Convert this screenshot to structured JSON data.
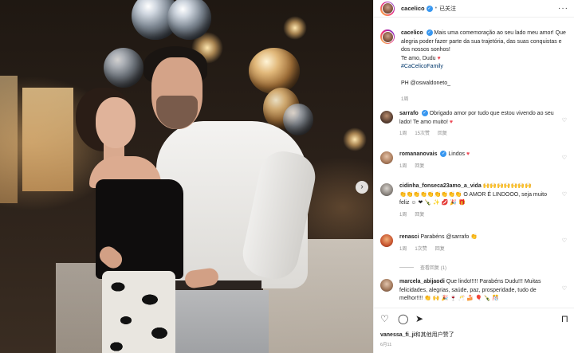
{
  "header": {
    "username": "cacelico",
    "verified_badge": "✓",
    "separator": "•",
    "follow_state": "已关注",
    "more_label": "···"
  },
  "caption": {
    "username": "cacelico",
    "verified_badge": "✓",
    "line1": "Mais uma comemoração ao seu lado meu amor! Que",
    "line2": "alegria poder fazer parte da sua trajetória, das suas conquistas e",
    "line3": "dos nossos sonhos!",
    "line4": "Te amo, Dudu",
    "heart": "♥",
    "hashtag": "#CaCelicoFamily",
    "credit": "PH @oswaldoneto_",
    "time": "1周"
  },
  "comments": [
    {
      "username": "sarrafo",
      "verified_badge": "✓",
      "line1": "Obrigado amor por tudo que estou vivendo ao seu",
      "line2": "lado! Te amo muito!",
      "heart": "♥",
      "time": "1周",
      "likes": "15次赞",
      "reply": "回复"
    },
    {
      "username": "romananovais",
      "verified_badge": "✓",
      "text": "Lindos",
      "heart": "♥",
      "time": "1周",
      "reply": "回复"
    },
    {
      "username": "cidinha_fonseca23amo_a_vida",
      "line1": "🙌🙌🙌🙌🙌🙌🙌",
      "line2": "👏👏👏👏👏👏👏👏👏 O AMOR É LINDOOO, seja muito",
      "line3": "feliz ☺ ❤ 🍾 ✨ 💋 🎉 🎁",
      "time": "1周",
      "reply": "回复"
    },
    {
      "username": "renasci",
      "text": "Parabéns @sarrafo 👏",
      "time": "1周",
      "likes": "1次赞",
      "reply": "回复",
      "view_replies": "查看回复 (1)"
    },
    {
      "username": "marcela_abijaodi",
      "line1": "Que lindo!!!!! Parabéns Dudu!!! Muitas",
      "line2": "felicidades, alegrias, saúde, paz, prosperidade, tudo de",
      "line3": "melhor!!!! 👏 🙌 🎉 🍷 🥂 🍰 🎈 🍾 🎊",
      "time": "1周"
    }
  ],
  "icons": {
    "like": "♡",
    "comment": "◯",
    "share": "➤",
    "save": "⊓",
    "comment_like": "♡",
    "next": "›"
  },
  "likes_line": {
    "user": "vanessa_fi_ji",
    "rest": "和其他用户赞了"
  },
  "date": "6月11"
}
